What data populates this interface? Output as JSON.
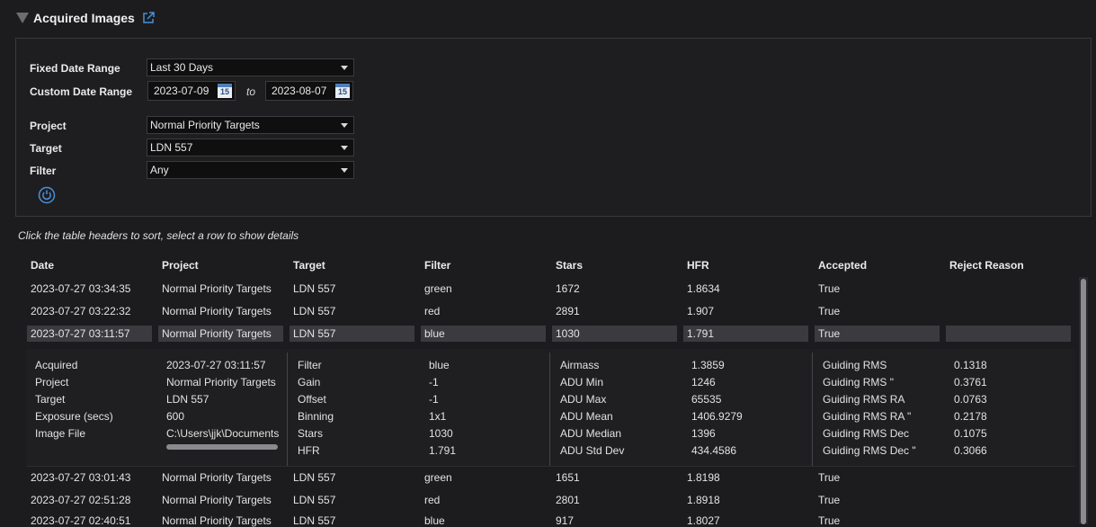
{
  "section": {
    "title": "Acquired Images"
  },
  "filters": {
    "fixed_date_range_label": "Fixed Date Range",
    "fixed_date_range_value": "Last 30 Days",
    "custom_date_range_label": "Custom Date Range",
    "date_from": "2023-07-09",
    "to_label": "to",
    "date_to": "2023-08-07",
    "calendar_day": "15",
    "project_label": "Project",
    "project_value": "Normal Priority Targets",
    "target_label": "Target",
    "target_value": "LDN 557",
    "filter_label": "Filter",
    "filter_value": "Any"
  },
  "hint": "Click the table headers to sort, select a row to show details",
  "table": {
    "headers": [
      "Date",
      "Project",
      "Target",
      "Filter",
      "Stars",
      "HFR",
      "Accepted",
      "Reject Reason"
    ],
    "rows": [
      [
        "2023-07-27 03:34:35",
        "Normal Priority Targets",
        "LDN 557",
        "green",
        "1672",
        "1.8634",
        "True",
        ""
      ],
      [
        "2023-07-27 03:22:32",
        "Normal Priority Targets",
        "LDN 557",
        "red",
        "2891",
        "1.907",
        "True",
        ""
      ],
      [
        "2023-07-27 03:11:57",
        "Normal Priority Targets",
        "LDN 557",
        "blue",
        "1030",
        "1.791",
        "True",
        ""
      ],
      [
        "2023-07-27 03:01:43",
        "Normal Priority Targets",
        "LDN 557",
        "green",
        "1651",
        "1.8198",
        "True",
        ""
      ],
      [
        "2023-07-27 02:51:28",
        "Normal Priority Targets",
        "LDN 557",
        "red",
        "2801",
        "1.8918",
        "True",
        ""
      ],
      [
        "2023-07-27 02:40:51",
        "Normal Priority Targets",
        "LDN 557",
        "blue",
        "917",
        "1.8027",
        "True",
        ""
      ]
    ]
  },
  "details": {
    "col1_labels": [
      "Acquired",
      "Project",
      "Target",
      "Exposure (secs)",
      "Image File"
    ],
    "col1_values": [
      "2023-07-27 03:11:57",
      "Normal Priority Targets",
      "LDN 557",
      "600",
      "C:\\Users\\jjk\\Documents"
    ],
    "col2_labels": [
      "Filter",
      "Gain",
      "Offset",
      "Binning",
      "Stars",
      "HFR"
    ],
    "col2_values": [
      "blue",
      "-1",
      "-1",
      "1x1",
      "1030",
      "1.791"
    ],
    "col3_labels": [
      "Airmass",
      "ADU Min",
      "ADU Max",
      "ADU Mean",
      "ADU Median",
      "ADU Std Dev"
    ],
    "col3_values": [
      "1.3859",
      "1246",
      "65535",
      "1406.9279",
      "1396",
      "434.4586"
    ],
    "col4_labels": [
      "Guiding RMS",
      "Guiding RMS \"",
      "Guiding RMS RA",
      "Guiding RMS RA \"",
      "Guiding RMS Dec",
      "Guiding RMS Dec \""
    ],
    "col4_values": [
      "0.1318",
      "0.3761",
      "0.0763",
      "0.2178",
      "0.1075",
      "0.3066"
    ]
  },
  "icons": {
    "collapse": "triangle-down-icon",
    "external_link": "external-link-icon",
    "calendar": "calendar-icon",
    "refresh": "refresh-icon"
  },
  "colors": {
    "accent": "#4a90d9",
    "background": "#1c1c1e",
    "selected_row": "#3b3b3f"
  }
}
